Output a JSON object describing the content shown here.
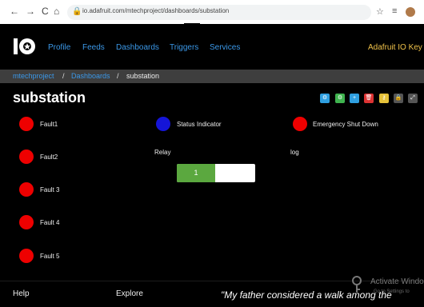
{
  "browser": {
    "back_icon": "←",
    "forward_icon": "→",
    "reload_icon": "C",
    "home_icon": "⌂",
    "lock_icon": "🔒",
    "url": "io.adafruit.com/mtechproject/dashboards/substation",
    "star_icon": "☆"
  },
  "header": {
    "logo_text": "IO",
    "nav": [
      "Profile",
      "Feeds",
      "Dashboards",
      "Triggers",
      "Services"
    ],
    "key_link": "Adafruit IO Key"
  },
  "breadcrumb": {
    "items": [
      "mtechproject",
      "Dashboards",
      "substation"
    ],
    "separator": "/"
  },
  "dashboard": {
    "title": "substation",
    "tools": [
      {
        "icon": "gear-icon",
        "glyph": "⚙",
        "color": "#2f9fe0"
      },
      {
        "icon": "settings-icon",
        "glyph": "⚙",
        "color": "#3fb34f"
      },
      {
        "icon": "plus-icon",
        "glyph": "+",
        "color": "#2f9fe0"
      },
      {
        "icon": "trash-icon",
        "glyph": "🗑",
        "color": "#d33"
      },
      {
        "icon": "key-icon",
        "glyph": "⚷",
        "color": "#e6c23a"
      },
      {
        "icon": "lock-icon",
        "glyph": "🔒",
        "color": "#555"
      },
      {
        "icon": "fullscreen-icon",
        "glyph": "⤢",
        "color": "#555"
      }
    ],
    "faults": [
      "Fault1",
      "Fault2",
      "Fault 3",
      "Fault 4",
      "Fault 5"
    ],
    "status_indicator": "Status Indicator",
    "emergency": "Emergency Shut Down",
    "relay_label": "Relay",
    "log_label": "log",
    "toggle_value": "1",
    "colors": {
      "red": "#ee0000",
      "blue": "#1515d8",
      "toggle_on": "#5ba83f"
    }
  },
  "footer": {
    "help": "Help",
    "explore": "Explore",
    "quote": "\"My father considered a walk among the",
    "watermark": "Activate Windo",
    "watermark_sub": "Go to Settings to"
  }
}
